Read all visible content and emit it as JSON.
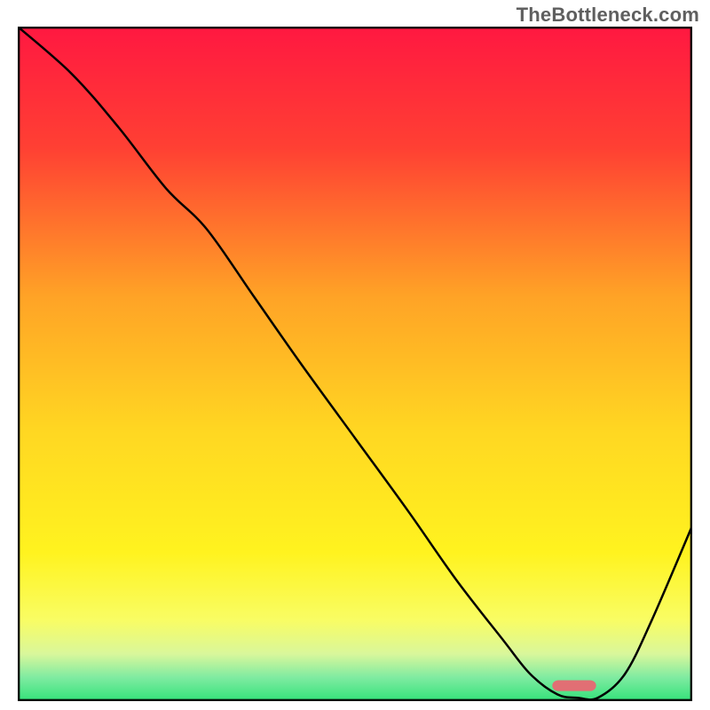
{
  "watermark": "TheBottleneck.com",
  "chart_data": {
    "type": "line",
    "title": "",
    "xlabel": "",
    "ylabel": "",
    "xlim": [
      0,
      100
    ],
    "ylim": [
      0,
      100
    ],
    "grid": false,
    "legend": false,
    "gradient_stops": [
      {
        "offset": 0.0,
        "color": "#ff1841"
      },
      {
        "offset": 0.18,
        "color": "#ff4033"
      },
      {
        "offset": 0.4,
        "color": "#ffa326"
      },
      {
        "offset": 0.6,
        "color": "#ffd722"
      },
      {
        "offset": 0.78,
        "color": "#fff31f"
      },
      {
        "offset": 0.88,
        "color": "#f9fd64"
      },
      {
        "offset": 0.93,
        "color": "#d9f79b"
      },
      {
        "offset": 0.965,
        "color": "#7feba1"
      },
      {
        "offset": 1.0,
        "color": "#33e27a"
      }
    ],
    "series": [
      {
        "name": "curve",
        "x": [
          0,
          8,
          15,
          22,
          28,
          35,
          42,
          50,
          58,
          65,
          72,
          76,
          80,
          83,
          86,
          90,
          94,
          100
        ],
        "y": [
          100,
          93,
          85,
          76,
          70,
          60,
          50,
          39,
          28,
          18,
          9,
          4,
          1,
          0.5,
          0.5,
          4,
          12,
          26
        ]
      }
    ],
    "marker": {
      "x": 82.5,
      "y": 2.3,
      "width": 6.5,
      "height": 1.6,
      "radius": 0.9,
      "fill": "#e16f74"
    },
    "axes_color": "#000000",
    "curve_color": "#000000"
  }
}
